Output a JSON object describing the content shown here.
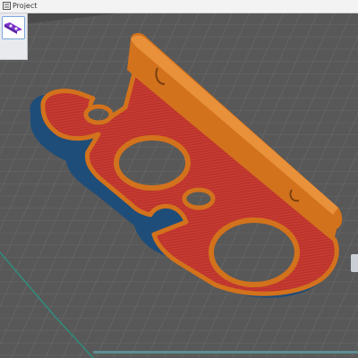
{
  "topbar": {
    "project_label": "Project"
  },
  "icons": {
    "project": "project-icon",
    "thumbnail": "model-thumbnail"
  },
  "colors": {
    "plate": "#595959",
    "grid_line": "#6c6c6c",
    "model_outline": "#d5741d",
    "model_infill": "#c93a31",
    "first_layer": "#1f4e7a",
    "progress": "#5e8e93"
  }
}
